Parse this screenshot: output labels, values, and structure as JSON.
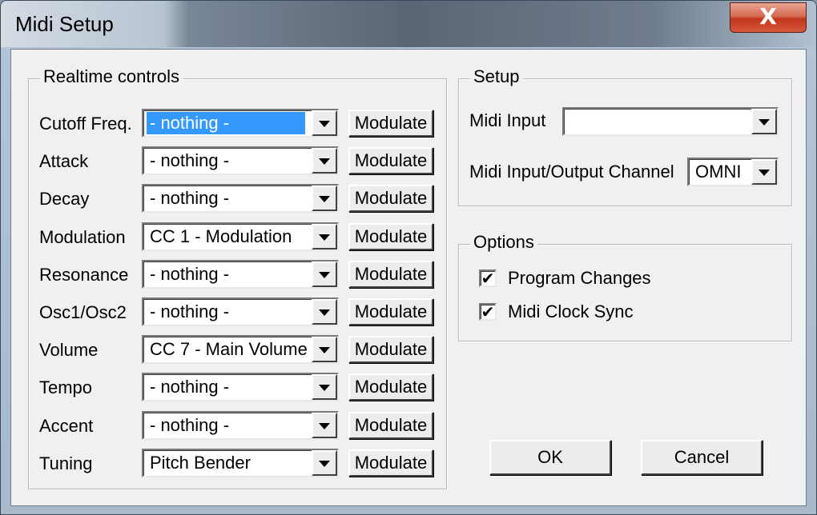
{
  "window": {
    "title": "Midi Setup",
    "close_glyph": "X"
  },
  "realtime": {
    "legend": "Realtime controls",
    "modulate_label": "Modulate",
    "rows": [
      {
        "label": "Cutoff Freq.",
        "value": "- nothing -",
        "selected": true
      },
      {
        "label": "Attack",
        "value": "- nothing -"
      },
      {
        "label": "Decay",
        "value": "- nothing -"
      },
      {
        "label": "Modulation",
        "value": "CC 1 - Modulation"
      },
      {
        "label": "Resonance",
        "value": "- nothing -"
      },
      {
        "label": "Osc1/Osc2",
        "value": "- nothing -"
      },
      {
        "label": "Volume",
        "value": "CC 7 - Main Volume"
      },
      {
        "label": "Tempo",
        "value": "- nothing -"
      },
      {
        "label": "Accent",
        "value": "- nothing -"
      },
      {
        "label": "Tuning",
        "value": "Pitch Bender"
      }
    ]
  },
  "setup": {
    "legend": "Setup",
    "midi_input_label": "Midi Input",
    "midi_input_value": "",
    "channel_label": "Midi Input/Output Channel",
    "channel_value": "OMNI"
  },
  "options": {
    "legend": "Options",
    "program_changes_label": "Program Changes",
    "program_changes_checked": true,
    "clock_sync_label": "Midi Clock Sync",
    "clock_sync_checked": true
  },
  "footer": {
    "ok_label": "OK",
    "cancel_label": "Cancel"
  }
}
